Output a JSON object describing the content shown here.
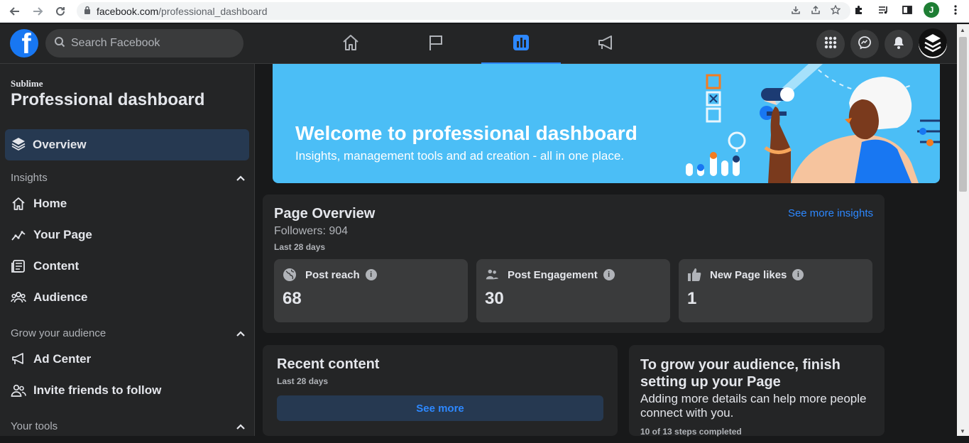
{
  "browser": {
    "url_domain": "facebook.com",
    "url_path": "/professional_dashboard",
    "profile_initial": "J"
  },
  "topbar": {
    "search_placeholder": "Search Facebook",
    "nav": [
      "home-icon",
      "flag-icon",
      "dashboard-icon",
      "megaphone-icon"
    ],
    "active_nav": "dashboard-icon",
    "accent": "#2d88ff"
  },
  "sidebar": {
    "page_name": "Sublime",
    "title": "Professional dashboard",
    "overview_label": "Overview",
    "insights_label": "Insights",
    "insights_items": [
      "Home",
      "Your Page",
      "Content",
      "Audience"
    ],
    "grow_label": "Grow your audience",
    "grow_items": [
      "Ad Center",
      "Invite friends to follow"
    ],
    "tools_label": "Your tools"
  },
  "banner": {
    "title": "Welcome to professional dashboard",
    "subtitle": "Insights, management tools and ad creation - all in one place.",
    "bg": "#4bbef6"
  },
  "page_overview": {
    "title": "Page Overview",
    "followers": "Followers: 904",
    "range": "Last 28 days",
    "link": "See more insights",
    "metrics": [
      {
        "label": "Post reach",
        "value": "68",
        "icon": "globe-icon"
      },
      {
        "label": "Post Engagement",
        "value": "30",
        "icon": "people-icon"
      },
      {
        "label": "New Page likes",
        "value": "1",
        "icon": "thumbs-up-icon"
      }
    ]
  },
  "recent_content": {
    "title": "Recent content",
    "range": "Last 28 days",
    "button": "See more"
  },
  "grow_card": {
    "title": "To grow your audience, finish setting up your Page",
    "desc": "Adding more details can help more people connect with you.",
    "steps": "10 of 13 steps completed"
  }
}
